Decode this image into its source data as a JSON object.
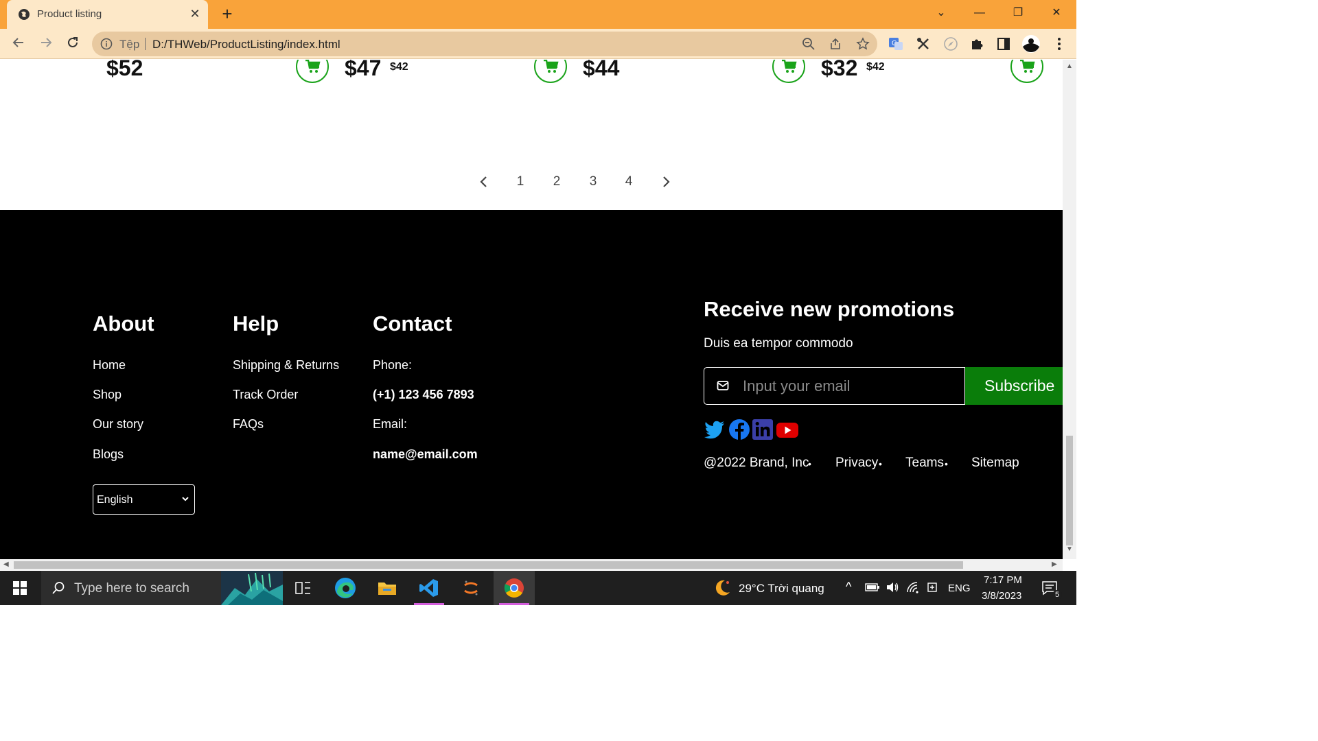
{
  "browser": {
    "tab_title": "Product listing",
    "tab_close": "✕",
    "new_tab": "+",
    "url_scheme_label": "Tệp",
    "url": "D:/THWeb/ProductListing/index.html",
    "window_controls": [
      "⌄",
      "—",
      "❐",
      "✕"
    ]
  },
  "products": {
    "prices": [
      "$52",
      "$47",
      "$44",
      "$32"
    ],
    "old_prices": [
      "$42",
      "$42"
    ]
  },
  "pagination": {
    "prev": "‹",
    "pages": [
      "1",
      "2",
      "3",
      "4"
    ],
    "next": "›"
  },
  "footer": {
    "about": {
      "heading": "About",
      "links": [
        "Home",
        "Shop",
        "Our story",
        "Blogs"
      ]
    },
    "help": {
      "heading": "Help",
      "links": [
        "Shipping & Returns",
        "Track Order",
        "FAQs"
      ]
    },
    "contact": {
      "heading": "Contact",
      "phone_label": "Phone:",
      "phone": "(+1) 123 456 7893",
      "email_label": "Email:",
      "email": "name@email.com"
    },
    "language": "English",
    "promo": {
      "heading": "Receive new promotions",
      "subtitle": "Duis ea tempor commodo",
      "email_placeholder": "Input your email",
      "subscribe": "Subscribe"
    },
    "social_icons": [
      "twitter-icon",
      "facebook-icon",
      "linkedin-icon",
      "youtube-icon"
    ],
    "copyright": "@2022 Brand, Inc",
    "bottom_links": [
      "Privacy",
      "Teams",
      "Sitemap"
    ]
  },
  "taskbar": {
    "search_placeholder": "Type here to search",
    "weather": "29°C  Trời quang",
    "language": "ENG",
    "time": "7:17 PM",
    "date": "3/8/2023",
    "notification_count": "5"
  },
  "colors": {
    "tab_strip": "#f9a33a",
    "toolbar": "#fde8c8",
    "cart_green": "#1aa31a",
    "subscribe_green": "#0a7d0a",
    "footer_bg": "#000000"
  }
}
